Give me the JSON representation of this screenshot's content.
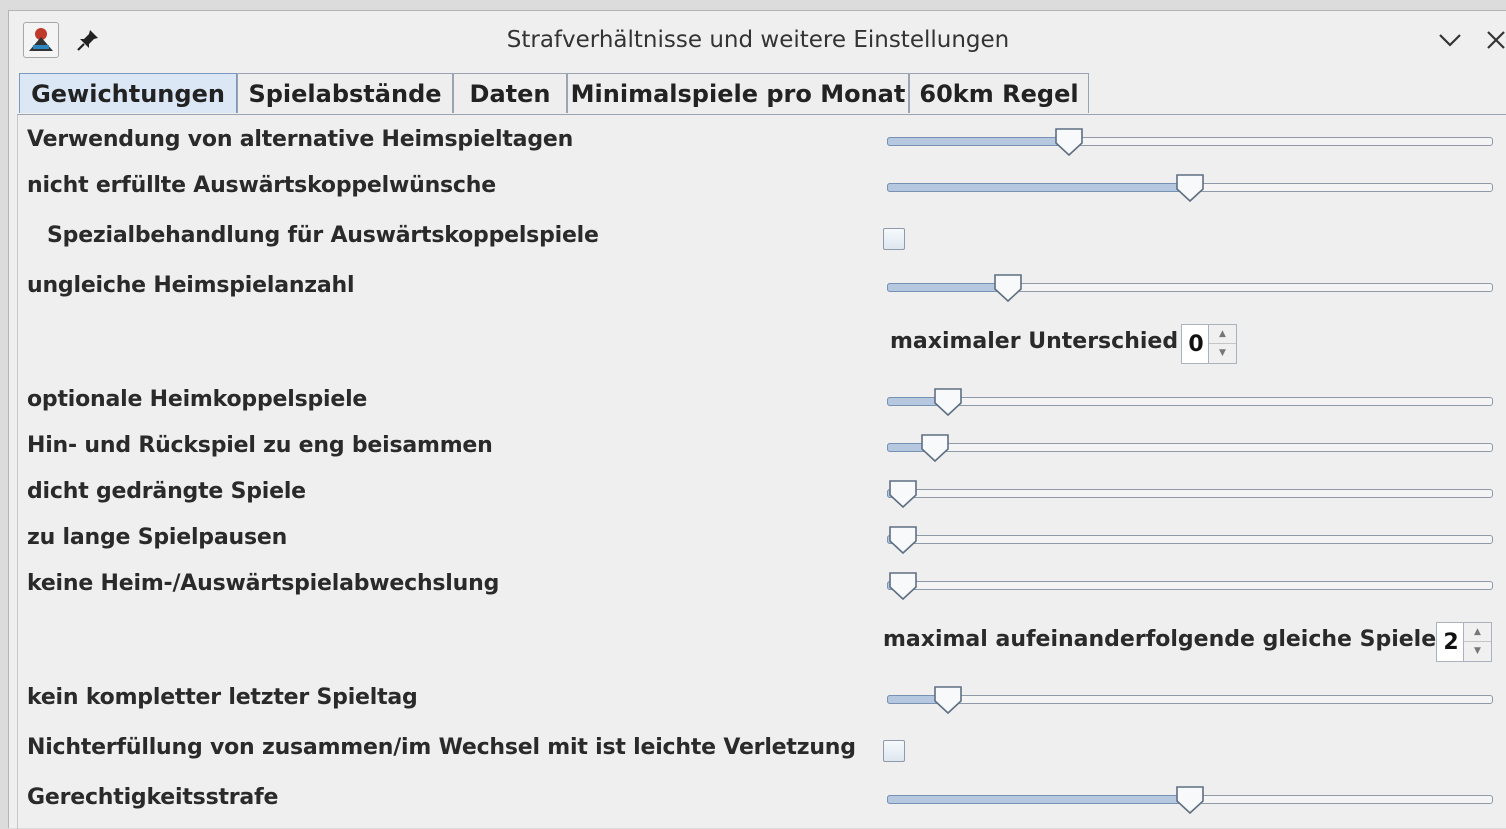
{
  "window": {
    "title": "Strafverhältnisse und weitere Einstellungen"
  },
  "tabs": [
    {
      "label": "Gewichtungen",
      "active": true
    },
    {
      "label": "Spielabstände",
      "active": false
    },
    {
      "label": "Daten",
      "active": false
    },
    {
      "label": "Minimalspiele pro Monat",
      "active": false
    },
    {
      "label": "60km Regel",
      "active": false
    }
  ],
  "settings": {
    "alt_home_days": {
      "label": "Verwendung von alternative Heimspieltagen",
      "value": 0.3
    },
    "away_pair_wishes": {
      "label": "nicht erfüllte Auswärtskoppelwünsche",
      "value": 0.5
    },
    "away_pair_special": {
      "label": "Spezialbehandlung für Auswärtskoppelspiele",
      "checked": false
    },
    "home_count": {
      "label": "ungleiche Heimspielanzahl",
      "value": 0.2
    },
    "max_difference": {
      "label": "maximaler Unterschied",
      "value": "0"
    },
    "optional_home_pairs": {
      "label": "optionale Heimkoppelspiele",
      "value": 0.1
    },
    "return_match_close": {
      "label": "Hin- und Rückspiel zu eng beisammen",
      "value": 0.08
    },
    "dense_games": {
      "label": "dicht gedrängte Spiele",
      "value": 0.02
    },
    "long_breaks": {
      "label": "zu lange Spielpausen",
      "value": 0.0
    },
    "no_alternation": {
      "label": "keine Heim-/Auswärtspielabwechslung",
      "value": 0.02
    },
    "max_consecutive": {
      "label": "maximal aufeinanderfolgende gleiche Spiele",
      "value": "2"
    },
    "incomplete_last_day": {
      "label": "kein kompletter letzter Spieltag",
      "value": 0.1
    },
    "together_minor": {
      "label": "Nichterfüllung von zusammen/im Wechsel mit ist leichte Verletzung",
      "checked": false
    },
    "fairness_penalty": {
      "label": "Gerechtigkeitsstrafe",
      "value": 0.5
    }
  },
  "colors": {
    "slider_fill": "#b6c8e0",
    "active_tab": "#dbe7f5"
  },
  "icons": [
    "app-icon",
    "pin-icon",
    "chevron-down-icon",
    "close-icon",
    "spin-up-icon",
    "spin-down-icon"
  ]
}
